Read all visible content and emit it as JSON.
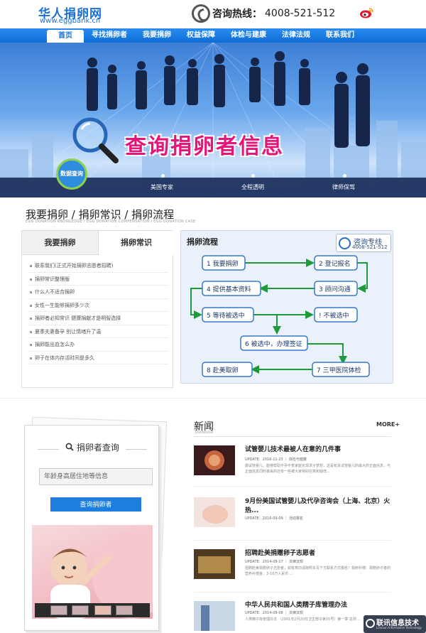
{
  "header": {
    "logo_cn": "华人捐卵网",
    "logo_en": "www.eggbank.cn",
    "hotline_label": "咨询热线：",
    "hotline_number": "4008-521-512",
    "icons": {
      "phone": "phone-icon",
      "weibo": "weibo-icon"
    }
  },
  "nav": {
    "items": [
      {
        "label": "首页",
        "active": true
      },
      {
        "label": "寻找捐卵者"
      },
      {
        "label": "我要捐卵"
      },
      {
        "label": "权益保障"
      },
      {
        "label": "体检与建康"
      },
      {
        "label": "法律法规"
      },
      {
        "label": "联系我们"
      }
    ]
  },
  "banner": {
    "title": "查询捐卵者信息",
    "badge": "数据查询",
    "strip": [
      "美国专家",
      "全程透明",
      "律师保驾"
    ]
  },
  "section": {
    "title": "我要捐卵 / 捐卵常识 / 捐卵流程",
    "subtitle": "EGG DONATION KNOWLEDGE / EGG DONATION COMPENSATION / EGG DONATION CASE"
  },
  "tabs": {
    "tab1": "我要捐卵",
    "tab2": "捐卵常识",
    "items": [
      "联系我们(正式开始捐卵志愿者招聘)",
      "捐卵常识整理版",
      "什么人不适合捐卵",
      "女性一生能够捐卵多少次",
      "捐卵者必知常识 健康捐献才是明智选择",
      "夏季夫妻备孕 别让情绪升了温",
      "捐卵能出血怎么办",
      "卵子在体内存活时间是多久"
    ]
  },
  "flow": {
    "title": "捐卵流程",
    "consult_label": "咨询专线",
    "consult_number": "4008-521-512",
    "steps": [
      "1 我要捐卵",
      "2 登记报名",
      "3 顾问沟通",
      "4 提供基本资料",
      "5 等待被选中",
      "! 不被选中",
      "6 被选中，办理签证",
      "7 三甲医院体检",
      "8 赴美取卵"
    ]
  },
  "search": {
    "title": "捐卵者查询",
    "placeholder": "年龄身高居住地等信息",
    "button": "查询捐卵者"
  },
  "news": {
    "title": "新闻",
    "subtitle": "JOURNALISM",
    "more": "MORE+",
    "items": [
      {
        "title": "试管婴儿技术最被人在意的几件事",
        "meta": "UPDATE：2016-11-23 ｜ 体检与健康",
        "desc": "做试管婴儿，能够帮助不孕不育家庭实现求子梦想，这是有关试管婴儿的最大的正面信息，与正面信息同时袭来的还有一些被大家特别在意和疑虑..."
      },
      {
        "title": "9月份美国试管婴儿及代孕咨询会（上海、北京）火热...",
        "meta": "UPDATE：2016-09-09 ｜ 活动报名",
        "desc": ""
      },
      {
        "title": "招聘赴美捐赠卵子志愿者",
        "meta": "UPDATE：2014-08-17 ｜ 法律法规",
        "desc": "招聘赴美捐赠卵子志愿者，如有意向请按照本页下方联系方式报名！捐卵补偿：捐赠卵子者的营养补偿金：3-10万人民币 ..."
      },
      {
        "title": "中华人民共和国人类精子库管理办法",
        "meta": "UPDATE：2014-08-08 ｜ 法律法规",
        "desc": "人类精子库管理办法 （2001年2月20日卫生部令第15号）第一章 总则 ..."
      }
    ]
  },
  "watermark": {
    "cn": "联讯信息技术",
    "en": "Lianxun Information Technology"
  }
}
